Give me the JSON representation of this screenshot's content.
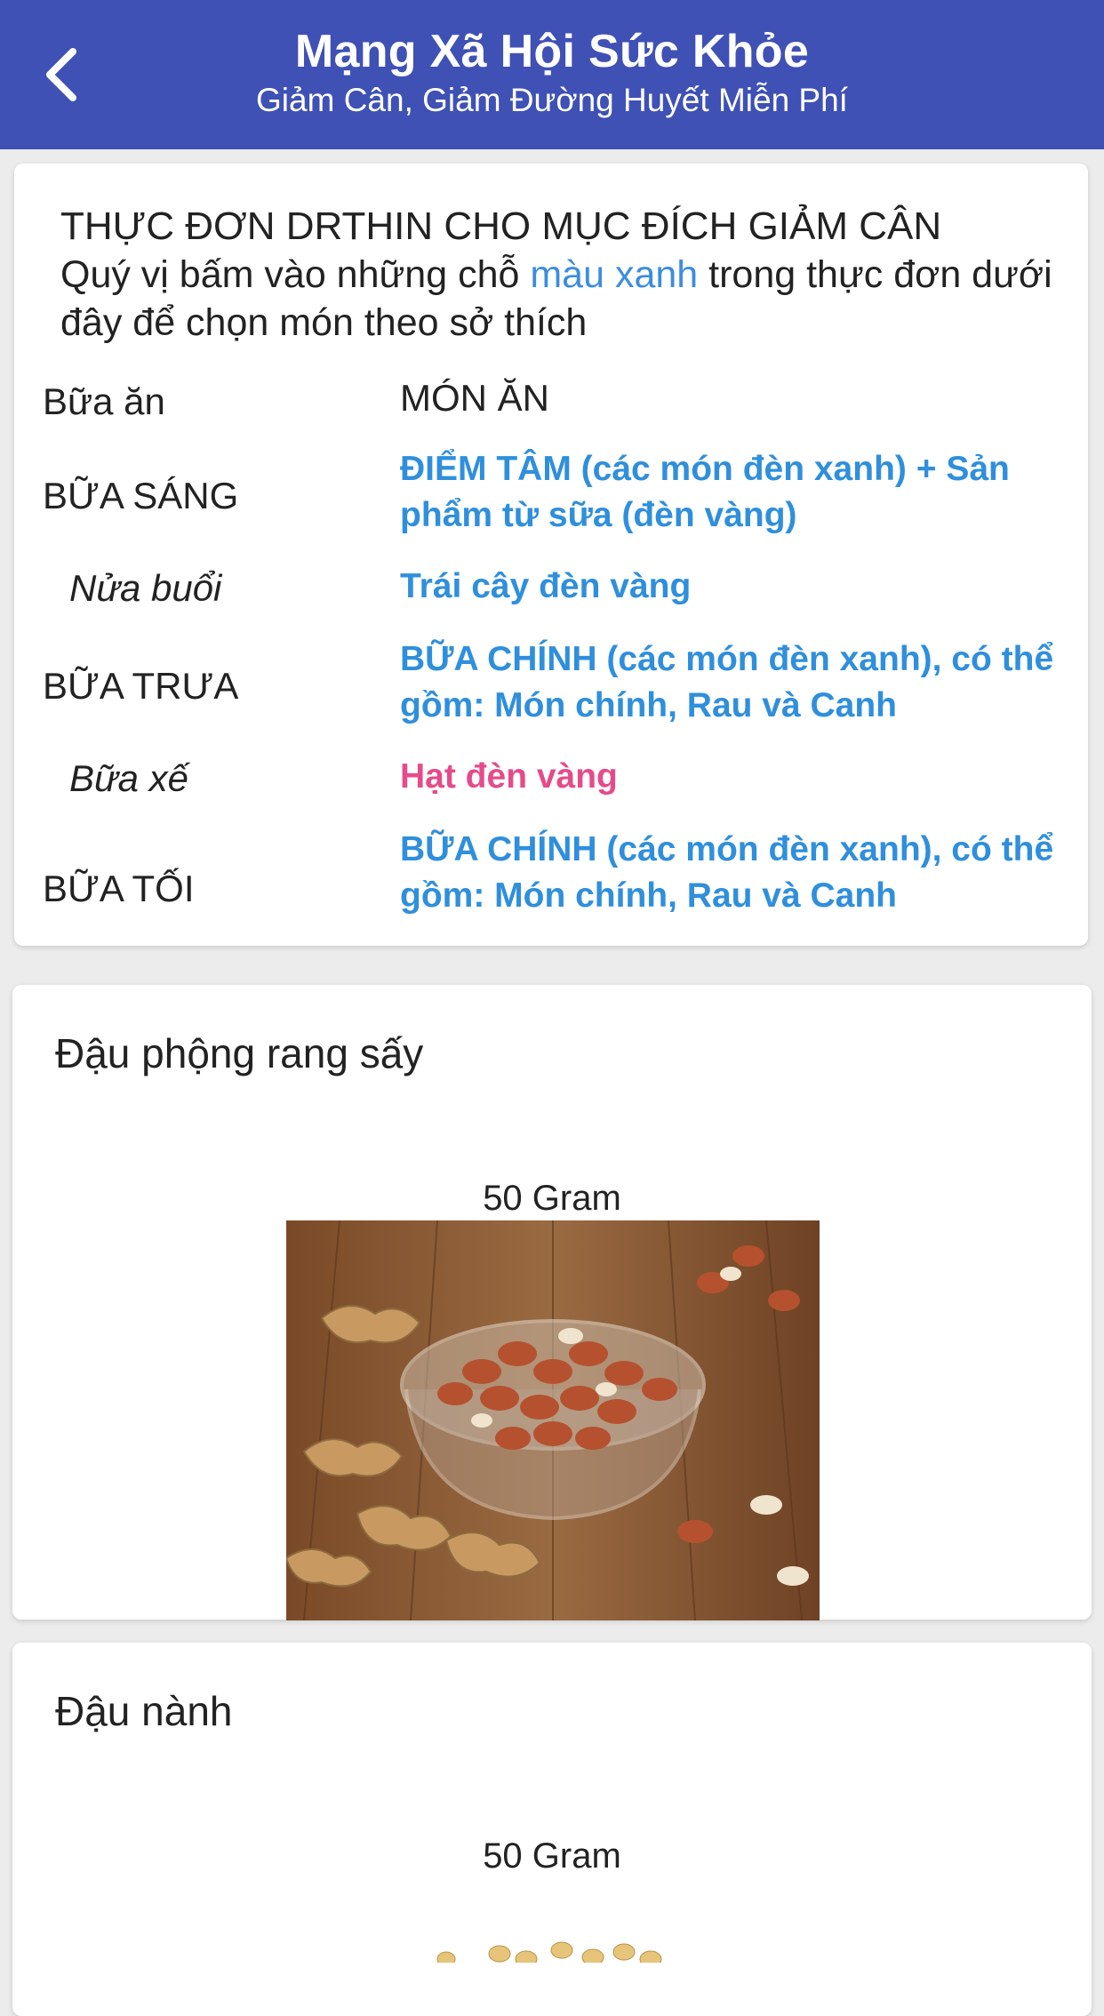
{
  "header": {
    "title": "Mạng Xã Hội Sức Khỏe",
    "subtitle": "Giảm Cân, Giảm Đường Huyết Miễn Phí"
  },
  "menu": {
    "heading": "THỰC ĐƠN DRTHIN CHO MỤC ĐÍCH GIẢM CÂN",
    "intro_before": "Quý vị bấm vào những chỗ ",
    "intro_link": "màu xanh",
    "intro_after": " trong thực đơn dưới đây để chọn món theo sở thích",
    "col_meal": "Bữa ăn",
    "col_dish": "MÓN ĂN",
    "rows": [
      {
        "meal": "BỮA SÁNG",
        "dish": "ĐIỂM TÂM (các món đèn xanh) + Sản phẩm từ sữa (đèn vàng)"
      },
      {
        "meal": "Nửa buổi",
        "dish": "Trái cây đèn vàng"
      },
      {
        "meal": "BỮA TRƯA",
        "dish": "BỮA CHÍNH (các món đèn xanh), có thể gồm: Món chính, Rau và Canh"
      },
      {
        "meal": "Bữa xế",
        "dish": "Hạt đèn vàng"
      },
      {
        "meal": "BỮA TỐI",
        "dish": "BỮA CHÍNH (các món đèn xanh), có thể gồm: Món chính, Rau và Canh"
      }
    ]
  },
  "foods": [
    {
      "name": "Đậu phộng rang sấy",
      "amount": "50 Gram",
      "image": "peanuts-in-glass-bowl"
    },
    {
      "name": "Đậu nành",
      "amount": "50 Gram",
      "image": "soybeans"
    }
  ],
  "colors": {
    "header_bg": "#3f51b5",
    "link_blue": "#2f8fdc",
    "highlight_pink": "#e54b8a"
  }
}
